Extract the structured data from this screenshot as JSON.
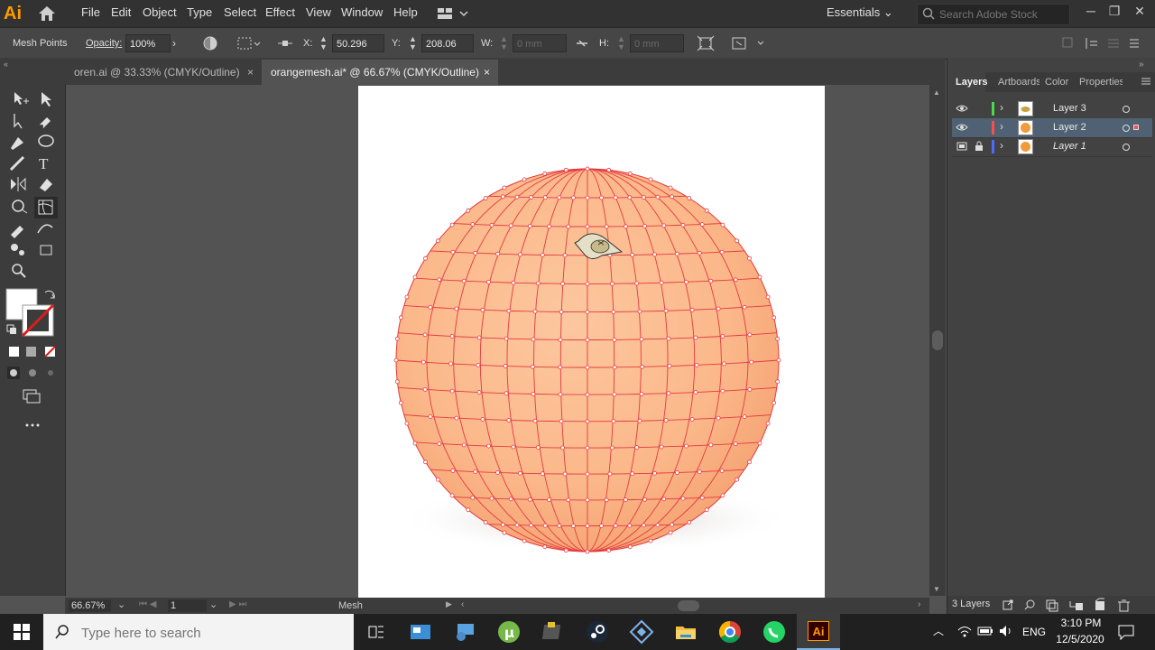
{
  "app": {
    "logo": "Ai"
  },
  "menu": {
    "items": [
      "File",
      "Edit",
      "Object",
      "Type",
      "Select",
      "Effect",
      "View",
      "Window",
      "Help"
    ]
  },
  "workspace": {
    "label": "Essentials"
  },
  "stock_search": {
    "placeholder": "Search Adobe Stock"
  },
  "control_bar": {
    "selection_label": "Mesh Points",
    "opacity_label": "Opacity:",
    "opacity_value": "100%",
    "x_label": "X:",
    "x_value": "50.296 mm",
    "y_label": "Y:",
    "y_value": "208.06 mm",
    "w_label": "W:",
    "w_value": "0 mm",
    "h_label": "H:",
    "h_value": "0 mm"
  },
  "tabs": [
    {
      "label": "oren.ai @ 33.33% (CMYK/Outline)",
      "close": "×"
    },
    {
      "label": "orangemesh.ai* @ 66.67% (CMYK/Outline)",
      "close": "×"
    }
  ],
  "status": {
    "zoom": "66.67%",
    "artboard_number": "1",
    "tool_name": "Mesh"
  },
  "layers_panel": {
    "tabs": [
      "Layers",
      "Artboards",
      "Color",
      "Properties"
    ],
    "layers": [
      {
        "name": "Layer 3",
        "color": "#4cd94c"
      },
      {
        "name": "Layer 2",
        "color": "#ff4d4d"
      },
      {
        "name": "Layer 1",
        "color": "#4d6bff"
      }
    ],
    "count_label": "3 Layers"
  },
  "colors": {
    "accent_orange": "#ff9a00",
    "mesh_line": "#e6393f",
    "orange_fill": "#fbb88a"
  },
  "taskbar": {
    "search_placeholder": "Type here to search",
    "language": "ENG",
    "time": "3:10 PM",
    "date": "12/5/2020"
  }
}
